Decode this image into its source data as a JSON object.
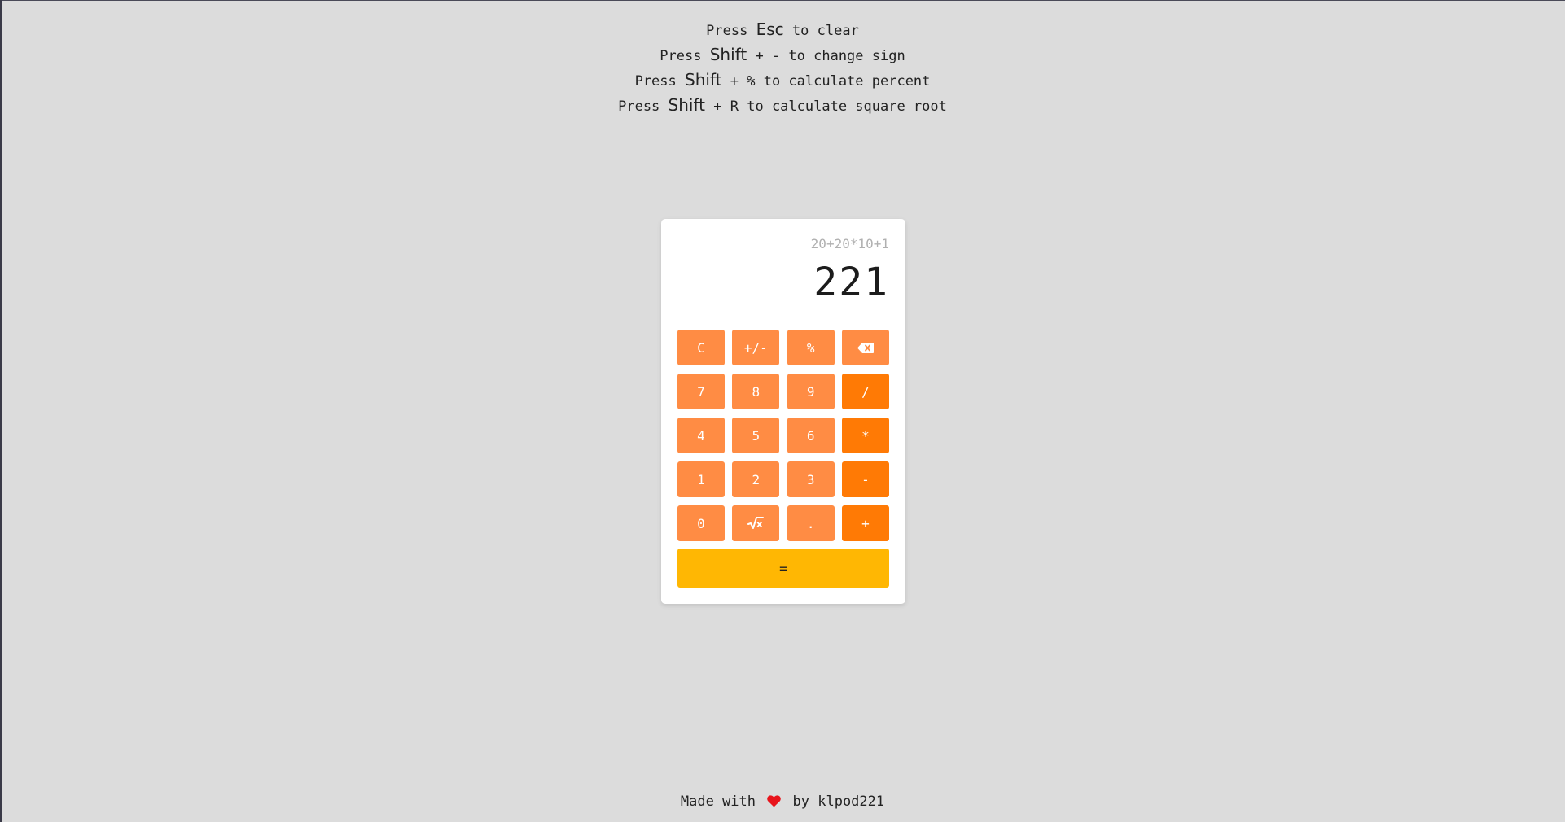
{
  "instructions": [
    {
      "pre": "Press",
      "key": "Esc",
      "post": "to clear"
    },
    {
      "pre": "Press",
      "key": "Shift",
      "mid": "+ -",
      "post": "to change sign"
    },
    {
      "pre": "Press",
      "key": "Shift",
      "mid": "+ %",
      "post": "to calculate percent"
    },
    {
      "pre": "Press",
      "key": "Shift",
      "mid": "+ R",
      "post": "to calculate square root"
    }
  ],
  "calculator": {
    "expression": "20+20*10+1",
    "result": "221",
    "keys": {
      "clear": "C",
      "sign": "+/-",
      "percent": "%",
      "backspace_icon": "backspace-icon",
      "seven": "7",
      "eight": "8",
      "nine": "9",
      "divide": "/",
      "four": "4",
      "five": "5",
      "six": "6",
      "multiply": "*",
      "one": "1",
      "two": "2",
      "three": "3",
      "minus": "-",
      "zero": "0",
      "sqrt_icon": "square-root-icon",
      "dot": ".",
      "plus": "+",
      "equals": "="
    },
    "colors": {
      "digit": "#ff8c44",
      "operator": "#ff7a05",
      "equals": "#ffb703",
      "background": "#dcdcdc"
    }
  },
  "footer": {
    "made_with": "Made with",
    "heart_icon": "heart-icon",
    "by": "by",
    "author": "klpod221"
  }
}
